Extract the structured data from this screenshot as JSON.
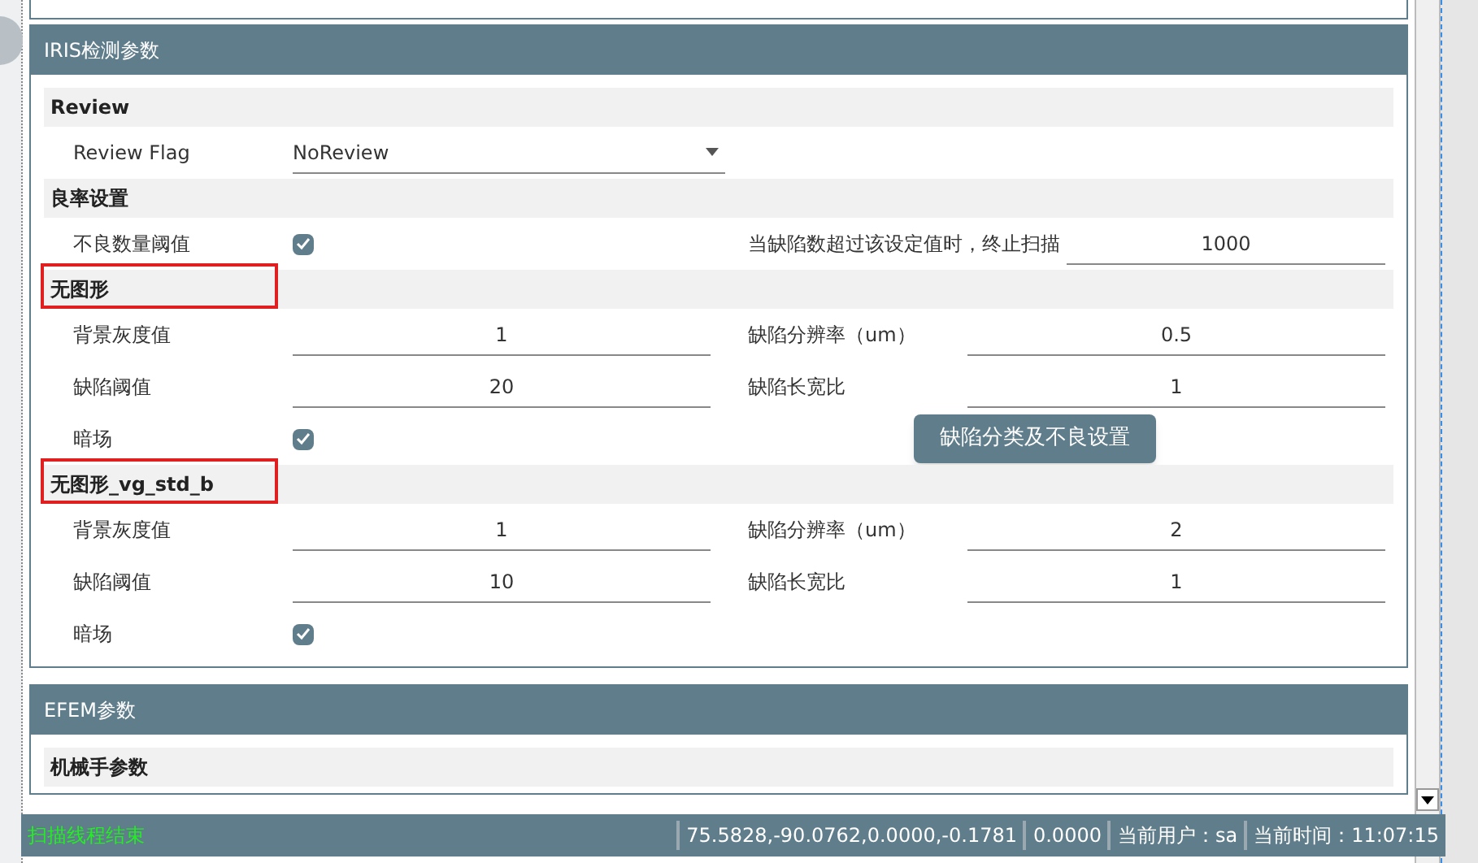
{
  "panels": [
    {
      "title": "IRIS检测参数",
      "groups": [
        {
          "title": "Review",
          "highlighted": false,
          "rows": [
            [
              {
                "kind": "dropdown",
                "label": "Review Flag",
                "value": "NoReview"
              }
            ]
          ]
        },
        {
          "title": "良率设置",
          "highlighted": false,
          "rows": [
            [
              {
                "kind": "checkbox",
                "label": "不良数量阈值",
                "checked": true
              },
              {
                "kind": "text",
                "label": "当缺陷数超过该设定值时，终止扫描",
                "value": "1000"
              }
            ]
          ]
        },
        {
          "title": "无图形",
          "highlighted": true,
          "rows": [
            [
              {
                "kind": "text",
                "label": "背景灰度值",
                "value": "1"
              },
              {
                "kind": "text",
                "label": "缺陷分辨率（um）",
                "value": "0.5"
              }
            ],
            [
              {
                "kind": "text",
                "label": "缺陷阈值",
                "value": "20"
              },
              {
                "kind": "text",
                "label": "缺陷长宽比",
                "value": "1"
              }
            ],
            [
              {
                "kind": "checkbox",
                "label": "暗场",
                "checked": true
              },
              {
                "kind": "button",
                "label": "缺陷分类及不良设置"
              }
            ]
          ]
        },
        {
          "title": "无图形_vg_std_b",
          "highlighted": true,
          "rows": [
            [
              {
                "kind": "text",
                "label": "背景灰度值",
                "value": "1"
              },
              {
                "kind": "text",
                "label": "缺陷分辨率（um）",
                "value": "2"
              }
            ],
            [
              {
                "kind": "text",
                "label": "缺陷阈值",
                "value": "10"
              },
              {
                "kind": "text",
                "label": "缺陷长宽比",
                "value": "1"
              }
            ],
            [
              {
                "kind": "checkbox",
                "label": "暗场",
                "checked": true
              }
            ]
          ]
        }
      ]
    },
    {
      "title": "EFEM参数",
      "groups": [
        {
          "title": "机械手参数",
          "highlighted": false
        }
      ]
    }
  ],
  "status_bar": {
    "message": "扫描线程结束",
    "segments": [
      "75.5828,-90.0762,0.0000,-0.1781",
      "0.0000",
      "当前用户：sa",
      "当前时间：11:07:15"
    ]
  }
}
